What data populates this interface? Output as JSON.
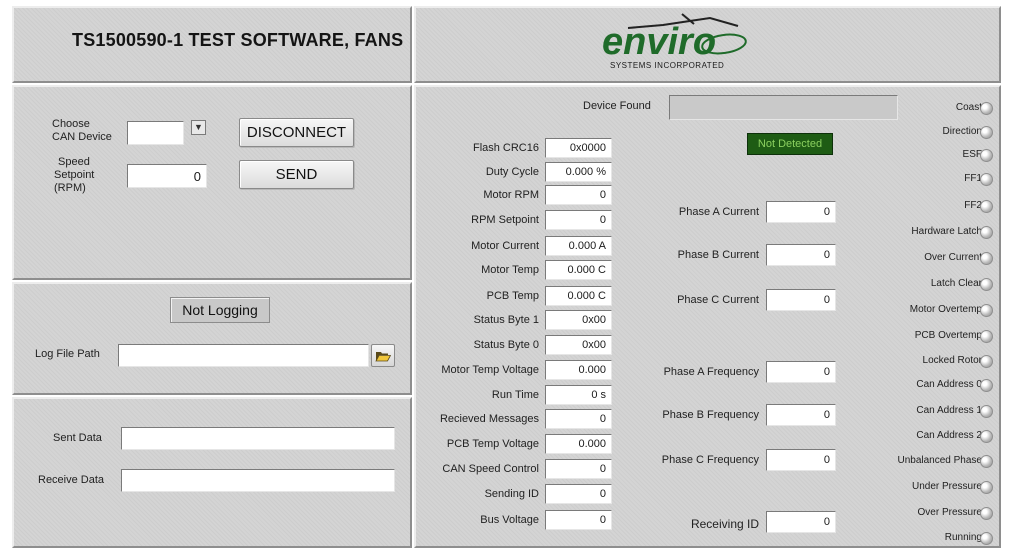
{
  "title": "TS1500590-1 TEST SOFTWARE, FANS",
  "logo": {
    "word": "enviro",
    "sub": "SYSTEMS INCORPORATED"
  },
  "can": {
    "choose_label_1": "Choose",
    "choose_label_2": "CAN Device",
    "device_value": "",
    "disconnect_label": "DISCONNECT",
    "speed_label_1": "Speed",
    "speed_label_2": "Setpoint",
    "speed_label_3": "(RPM)",
    "speed_value": "0",
    "send_label": "SEND"
  },
  "logging": {
    "status_label": "Not Logging",
    "path_label": "Log File Path",
    "path_value": ""
  },
  "data": {
    "sent_label": "Sent Data",
    "sent_value": "",
    "receive_label": "Receive Data",
    "receive_value": ""
  },
  "device": {
    "found_label": "Device Found",
    "found_value": "",
    "not_detected": "Not Detected"
  },
  "readouts": [
    {
      "label": "Flash CRC16",
      "value": "0x0000"
    },
    {
      "label": "Duty Cycle",
      "value": "0.000 %"
    },
    {
      "label": "Motor RPM",
      "value": "0"
    },
    {
      "label": "RPM Setpoint",
      "value": "0"
    },
    {
      "label": "Motor Current",
      "value": "0.000 A"
    },
    {
      "label": "Motor Temp",
      "value": "0.000 C"
    },
    {
      "label": "PCB Temp",
      "value": "0.000 C"
    },
    {
      "label": "Status Byte 1",
      "value": "0x00"
    },
    {
      "label": "Status Byte 0",
      "value": "0x00"
    },
    {
      "label": "Motor Temp Voltage",
      "value": "0.000"
    },
    {
      "label": "Run Time",
      "value": "0 s"
    },
    {
      "label": "Recieved Messages",
      "value": "0"
    },
    {
      "label": "PCB Temp Voltage",
      "value": "0.000"
    },
    {
      "label": "CAN Speed Control",
      "value": "0"
    },
    {
      "label": "Sending ID",
      "value": "0"
    },
    {
      "label": "Bus Voltage",
      "value": "0"
    }
  ],
  "phase": [
    {
      "label": "Phase A Current",
      "value": "0"
    },
    {
      "label": "Phase B Current",
      "value": "0"
    },
    {
      "label": "Phase C Current",
      "value": "0"
    },
    {
      "label": "Phase A Frequency",
      "value": "0"
    },
    {
      "label": "Phase B Frequency",
      "value": "0"
    },
    {
      "label": "Phase C Frequency",
      "value": "0"
    },
    {
      "label": "Receiving ID",
      "value": "0"
    }
  ],
  "indicators": [
    "Coast",
    "Direction",
    "ESF",
    "FF1",
    "FF2",
    "Hardware Latch",
    "Over Current",
    "Latch Clear",
    "Motor Overtemp",
    "PCB Overtemp",
    "Locked Rotor",
    "Can Address 0",
    "Can Address 1",
    "Can Address 2",
    "Unbalanced Phase",
    "Under Pressure",
    "Over Pressure",
    "Running"
  ],
  "colors": {
    "panel": "#d4d4d4",
    "logo_green": "#1f6b2a",
    "led_off": "#b9b9b9",
    "not_detected_bg": "#1e5c14"
  },
  "icons": {
    "dropdown": "chevron-down-icon",
    "folder": "folder-open-icon",
    "indicator": "led-indicator-icon"
  }
}
